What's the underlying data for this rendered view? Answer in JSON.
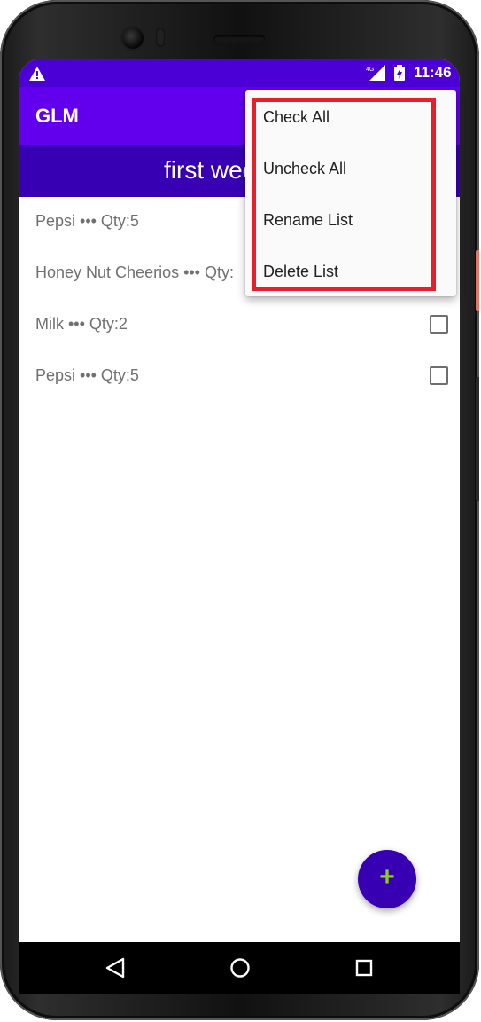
{
  "status_bar": {
    "time": "11:46",
    "network": "4G",
    "left_icon": "warning-icon",
    "colors": {
      "background": "#4b00d6"
    }
  },
  "app_bar": {
    "title": "GLM",
    "colors": {
      "background": "#6200ee"
    }
  },
  "list_header": {
    "title": "first week",
    "colors": {
      "background": "#3700b3"
    }
  },
  "items": [
    {
      "text": "Pepsi ••• Qty:5"
    },
    {
      "text": "Honey Nut Cheerios ••• Qty:"
    },
    {
      "text": "Milk ••• Qty:2"
    },
    {
      "text": "Pepsi ••• Qty:5"
    }
  ],
  "overflow_menu": {
    "items": [
      {
        "label": "Check All"
      },
      {
        "label": "Uncheck All"
      },
      {
        "label": "Rename List"
      },
      {
        "label": "Delete List"
      }
    ],
    "highlight_color": "#e5202a"
  },
  "fab": {
    "symbol": "+",
    "icon": "plus-icon",
    "colors": {
      "background": "#3700b3",
      "icon": "#8cd113"
    }
  },
  "nav_bar": {
    "icons": [
      "back-icon",
      "home-icon",
      "recents-icon"
    ]
  }
}
